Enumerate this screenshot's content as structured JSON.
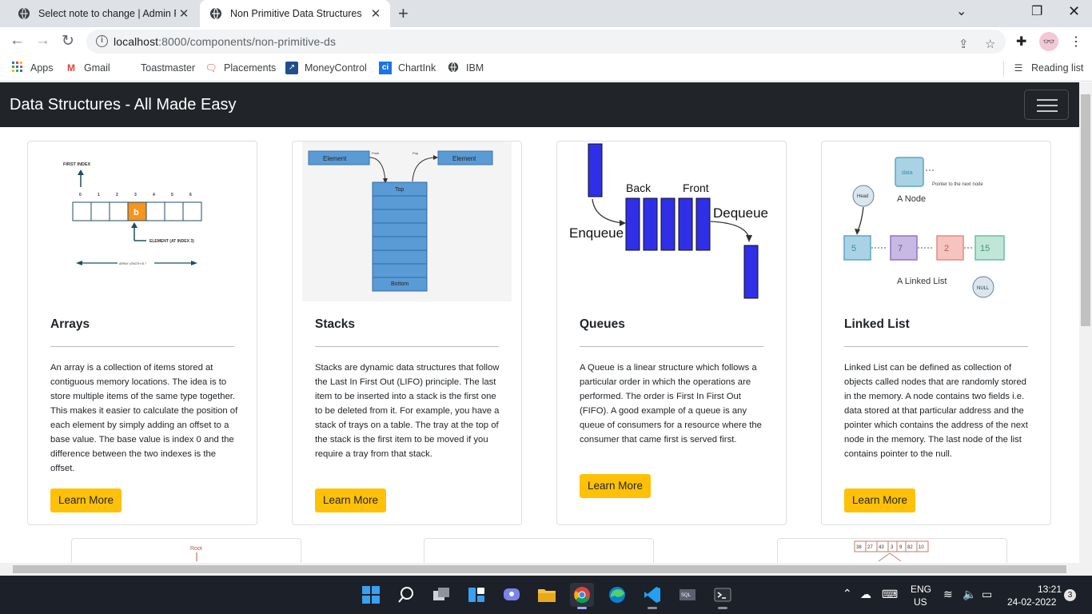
{
  "browser": {
    "tabs": [
      {
        "title": "Select note to change | Admin Pa",
        "active": false
      },
      {
        "title": "Non Primitive Data Structures",
        "active": true
      }
    ],
    "url_host": "localhost",
    "url_path": ":8000/components/non-primitive-ds",
    "bookmarks": [
      "Apps",
      "Gmail",
      "Toastmaster",
      "Placements",
      "MoneyControl",
      "ChartInk",
      "IBM"
    ],
    "reading_list": "Reading list"
  },
  "page": {
    "brand": "Data Structures - All Made Easy",
    "cards": [
      {
        "title": "Arrays",
        "text": "An array is a collection of items stored at contiguous memory locations. The idea is to store multiple items of the same type together. This makes it easier to calculate the position of each element by simply adding an offset to a base value. The base value is index 0 and the difference between the two indexes is the offset.",
        "button": "Learn More"
      },
      {
        "title": "Stacks",
        "text": "Stacks are dynamic data structures that follow the Last In First Out (LIFO) principle. The last item to be inserted into a stack is the first one to be deleted from it. For example, you have a stack of trays on a table. The tray at the top of the stack is the first item to be moved if you require a tray from that stack.",
        "button": "Learn More"
      },
      {
        "title": "Queues",
        "text": "A Queue is a linear structure which follows a particular order in which the operations are performed. The order is First In First Out (FIFO). A good example of a queue is any queue of consumers for a resource where the consumer that came first is served first.",
        "button": "Learn More"
      },
      {
        "title": "Linked List",
        "text": "Linked List can be defined as collection of objects called nodes that are randomly stored in the memory. A node contains two fields i.e. data stored at that particular address and the pointer which contains the address of the next node in the memory. The last node of the list contains pointer to the null.",
        "button": "Learn More"
      }
    ],
    "images": {
      "array": {
        "first_index": "FIRST INDEX",
        "indices": [
          "0",
          "1",
          "2",
          "3",
          "4",
          "5",
          "6"
        ],
        "highlight": "b",
        "element_label": "ELEMENT (AT INDEX 3)",
        "length_label": "ARRAY LENGTH IS 7"
      },
      "stack": {
        "element_left": "Element",
        "element_right": "Element",
        "push": "Push",
        "pop": "Pop",
        "top": "Top",
        "bottom": "Bottom"
      },
      "queue": {
        "back": "Back",
        "front": "Front",
        "enqueue": "Enqueue",
        "dequeue": "Dequeue"
      },
      "linked": {
        "data": "data",
        "pointer": "Pointer to the next node",
        "a_node": "A Node",
        "head": "Head",
        "nodes": [
          "5",
          "7",
          "2",
          "15"
        ],
        "a_linked_list": "A Linked List",
        "null": "NULL"
      },
      "tree": {
        "root": "Root"
      },
      "hash": {
        "cells": [
          "38",
          "27",
          "43",
          "3",
          "9",
          "82",
          "10"
        ]
      }
    }
  },
  "taskbar": {
    "lang": "ENG",
    "region": "US",
    "time": "13:21",
    "date": "24-02-2022",
    "notifications": "3"
  },
  "colors": {
    "navbar": "#212529",
    "button": "#ffc107",
    "stack_blue": "#5b9bd5",
    "queue_blue": "#2f2fe8",
    "array_orange": "#f7941d"
  }
}
